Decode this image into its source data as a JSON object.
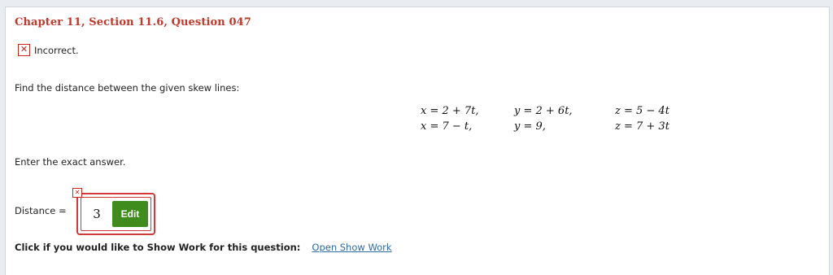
{
  "header": {
    "title": "Chapter 11, Section 11.6, Question 047"
  },
  "status": {
    "icon": "incorrect-x-icon",
    "text": "Incorrect."
  },
  "question": {
    "prompt": "Find the distance between the given skew lines:",
    "equations": [
      [
        "x = 2 + 7t,",
        "y = 2 + 6t,",
        "z = 5 − 4t"
      ],
      [
        "x = 7 − t,",
        "y = 9,",
        "z = 7 + 3t"
      ]
    ]
  },
  "instruction": "Enter the exact answer.",
  "answer": {
    "label": "Distance =",
    "value": "3",
    "edit_label": "Edit"
  },
  "show_work": {
    "prompt": "Click if you would like to Show Work for this question:",
    "link": "Open Show Work"
  },
  "colors": {
    "header": "#c0392b",
    "incorrect": "#d0261a",
    "edit_button": "#3f8b1c",
    "link": "#2c6ca8"
  }
}
